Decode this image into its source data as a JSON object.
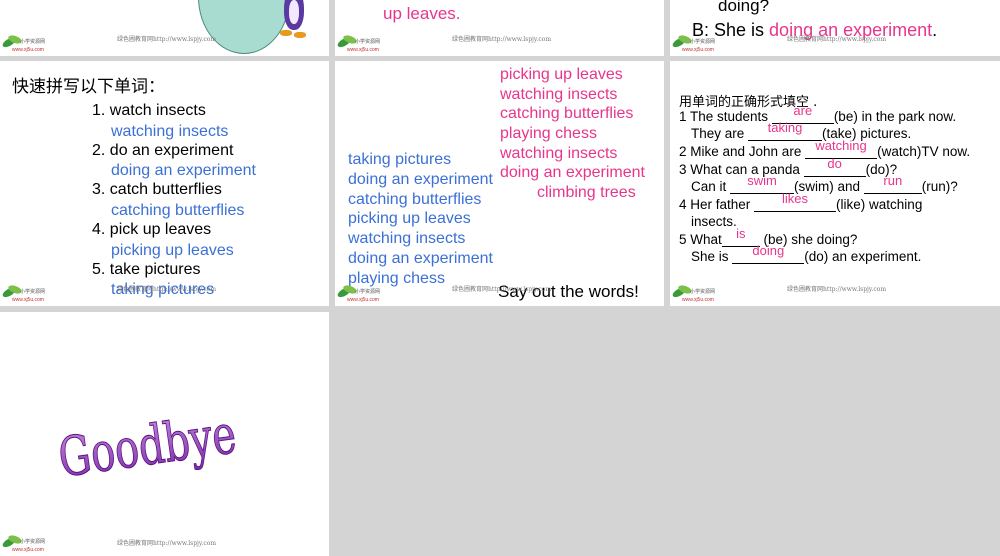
{
  "footer_text": "绿色圃教育网http://www.lspjy.com",
  "logo": {
    "cn": "小学资源网",
    "url": "www.xj5u.com"
  },
  "slide2": {
    "line1": "up leaves."
  },
  "slide3": {
    "line1": "doing?",
    "line2_prefix": "B: She is ",
    "line2_answer": "doing an experiment",
    "line2_suffix": "."
  },
  "slide4": {
    "heading": "快速拼写以下单词：",
    "items": [
      {
        "q": "1. watch insects",
        "a": "watching insects"
      },
      {
        "q": "2. do an experiment",
        "a": "doing an experiment"
      },
      {
        "q": "3. catch butterflies",
        "a": "catching butterflies"
      },
      {
        "q": "4. pick up leaves",
        "a": "picking up leaves"
      },
      {
        "q": "5. take pictures",
        "a": "taking pictures"
      }
    ]
  },
  "slide5": {
    "blue_list": [
      "taking pictures",
      "doing an experiment",
      "catching butterflies",
      "picking up leaves",
      "watching insects",
      "doing an experiment",
      "playing chess"
    ],
    "pink_list": [
      "picking up leaves",
      "watching insects",
      "catching butterflies",
      "playing chess",
      "watching insects",
      "doing an experiment",
      "climbing trees"
    ],
    "say_out": "Say out the words!"
  },
  "slide6": {
    "heading": "用单词的正确形式填空 .",
    "answers": {
      "a1": "are",
      "a2": "taking",
      "a3": "watching",
      "a4": "do",
      "a5": "swim",
      "a6": "run",
      "a7": "likes",
      "a8": "is",
      "a9": "doing"
    },
    "t": {
      "l1a": "1 The students ",
      "l1b": "(be) in the park now.",
      "l2a": "They are ",
      "l2b": "(take) pictures.",
      "l3a": "2 Mike and John are ",
      "l3b": "(watch)TV now.",
      "l4a": "3 What can a panda ",
      "l4b": "(do)?",
      "l5a": "Can it ",
      "l5b": "(swim) and ",
      "l5c": "(run)?",
      "l6a": "4 Her father ",
      "l6b": "(like) watching",
      "l7a": "insects.",
      "l8a": "5 What",
      "l8b": " (be) she doing?",
      "l9a": "She is ",
      "l9b": "(do) an experiment."
    }
  },
  "slide7": {
    "goodbye": "Goodbye"
  }
}
